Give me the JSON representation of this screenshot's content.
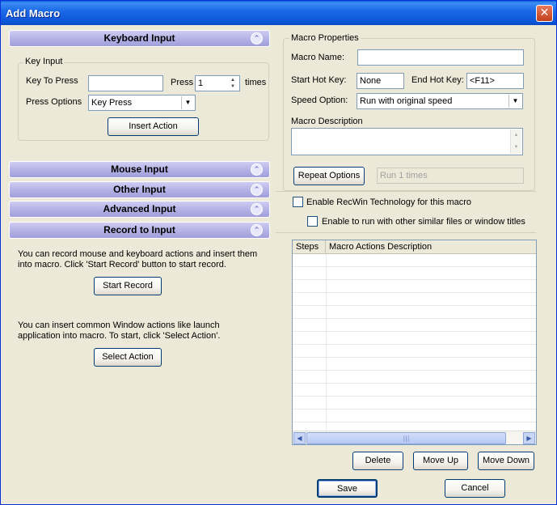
{
  "window": {
    "title": "Add Macro",
    "close_glyph": "✕"
  },
  "left": {
    "keyboard_input": {
      "header": "Keyboard Input"
    },
    "key_input": {
      "group_label": "Key Input",
      "key_to_press_label": "Key To Press",
      "key_to_press_value": "",
      "press_label": "Press",
      "press_count": "1",
      "times_label": "times",
      "press_options_label": "Press Options",
      "press_options_value": "Key Press",
      "insert_action": "Insert Action"
    },
    "mouse_input": {
      "header": "Mouse Input"
    },
    "other_input": {
      "header": "Other Input"
    },
    "advanced_input": {
      "header": "Advanced Input"
    },
    "record_to_input": {
      "header": "Record to Input",
      "record_text_1": "You can record mouse and keyboard actions and insert them",
      "record_text_2": "into macro. Click 'Start Record' button to start record.",
      "start_record": "Start Record",
      "window_text_1": "You can insert common Window actions like launch",
      "window_text_2": "application into macro. To start, click 'Select Action'.",
      "select_action": "Select Action"
    },
    "chevron_glyph": "⌃"
  },
  "right": {
    "macro_properties": {
      "group_label": "Macro Properties",
      "macro_name_label": "Macro Name:",
      "macro_name_value": "",
      "start_hot_key_label": "Start Hot Key:",
      "start_hot_key_value": "None",
      "end_hot_key_label": "End Hot Key:",
      "end_hot_key_value": "<F11>",
      "speed_option_label": "Speed Option:",
      "speed_option_value": "Run with original speed",
      "macro_description_label": "Macro Description",
      "macro_description_value": "",
      "repeat_options": "Repeat Options",
      "repeat_value": "Run 1 times"
    },
    "enable_recwin": "Enable RecWin Technology for this macro",
    "enable_run_similar": "Enable to run with other similar files or window titles",
    "actions_table": {
      "columns": [
        "Steps",
        "Macro Actions Description"
      ],
      "rows": []
    },
    "delete": "Delete",
    "move_up": "Move Up",
    "move_down": "Move Down"
  },
  "footer": {
    "save": "Save",
    "cancel": "Cancel"
  }
}
